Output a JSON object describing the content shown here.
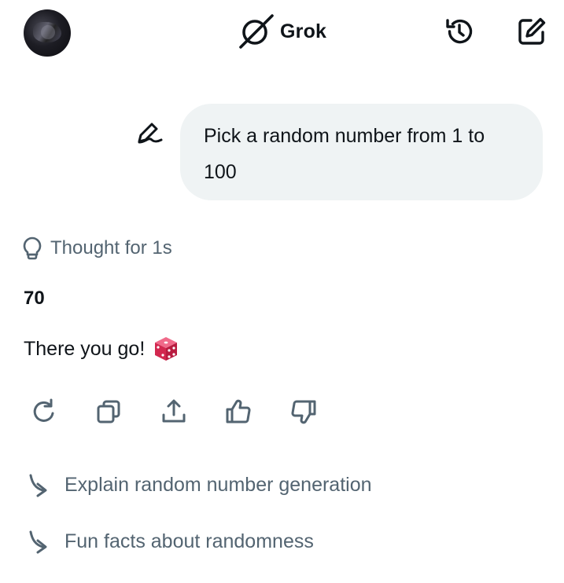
{
  "header": {
    "brand_name": "Grok",
    "avatar_icon": "user-avatar",
    "logo_icon": "grok-logo-icon",
    "history_icon": "history-icon",
    "compose_icon": "new-chat-icon"
  },
  "conversation": {
    "user_message": "Pick a random number from 1 to 100",
    "edit_icon": "edit-message-icon",
    "thought_label": "Thought for 1s",
    "thought_icon": "lightbulb-icon",
    "answer_number": "70",
    "answer_text": "There you go!",
    "answer_emoji_icon": "game-die-icon"
  },
  "actions": [
    {
      "name": "regenerate",
      "icon": "refresh-icon"
    },
    {
      "name": "copy",
      "icon": "copy-icon"
    },
    {
      "name": "share",
      "icon": "share-icon"
    },
    {
      "name": "like",
      "icon": "thumbs-up-icon"
    },
    {
      "name": "dislike",
      "icon": "thumbs-down-icon"
    }
  ],
  "suggestions": [
    {
      "text": "Explain random number generation",
      "icon": "follow-up-arrow-icon"
    },
    {
      "text": "Fun facts about randomness",
      "icon": "follow-up-arrow-icon"
    }
  ],
  "colors": {
    "text_primary": "#0f1419",
    "text_secondary": "#536471",
    "bubble_bg": "#eff3f4",
    "dice_red": "#e0325f"
  }
}
